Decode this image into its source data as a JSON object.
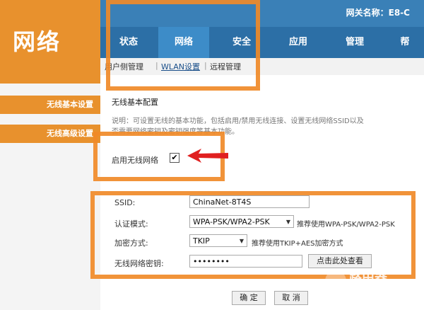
{
  "header": {
    "logo": "网络",
    "gateway_label": "网关名称：E8-C",
    "tabs": [
      {
        "label": "状态",
        "active": false
      },
      {
        "label": "网络",
        "active": true
      },
      {
        "label": "安全",
        "active": false
      },
      {
        "label": "应用",
        "active": false
      },
      {
        "label": "管理",
        "active": false
      },
      {
        "label": "帮",
        "active": false
      }
    ],
    "subnav": [
      {
        "label": "用户侧管理",
        "active": false
      },
      {
        "label": "WLAN设置",
        "active": true
      },
      {
        "label": "远程管理",
        "active": false
      }
    ]
  },
  "sidebar": {
    "items": [
      {
        "label": "无线基本设置"
      },
      {
        "label": "无线高级设置"
      }
    ]
  },
  "main": {
    "section_title": "无线基本配置",
    "description_1": "说明：可设置无线的基本功能，包括启用/禁用无线连接、设置无线网络SSID以及",
    "description_2": "否需要网络密钥及密钥强度等基本功能。",
    "enable_label": "启用无线网络",
    "enable_checked": true,
    "ssid_label": "SSID:",
    "ssid_value": "ChinaNet-8T4S",
    "auth_label": "认证模式:",
    "auth_value": "WPA-PSK/WPA2-PSK",
    "auth_hint": "推荐使用WPA-PSK/WPA2-PSK",
    "enc_label": "加密方式:",
    "enc_value": "TKIP",
    "enc_hint": "推荐使用TKIP+AES加密方式",
    "key_label": "无线网络密钥:",
    "key_value": "••••••••",
    "view_button": "点击此处查看",
    "ok_button": "确 定",
    "cancel_button": "取 消"
  },
  "watermark": {
    "text": "路由器",
    "sub": "luyouqi.com"
  },
  "colors": {
    "highlight": "#f08a28",
    "brand_orange": "#e8912d",
    "nav_blue": "#2c6fa6",
    "arrow_red": "#e02020"
  }
}
